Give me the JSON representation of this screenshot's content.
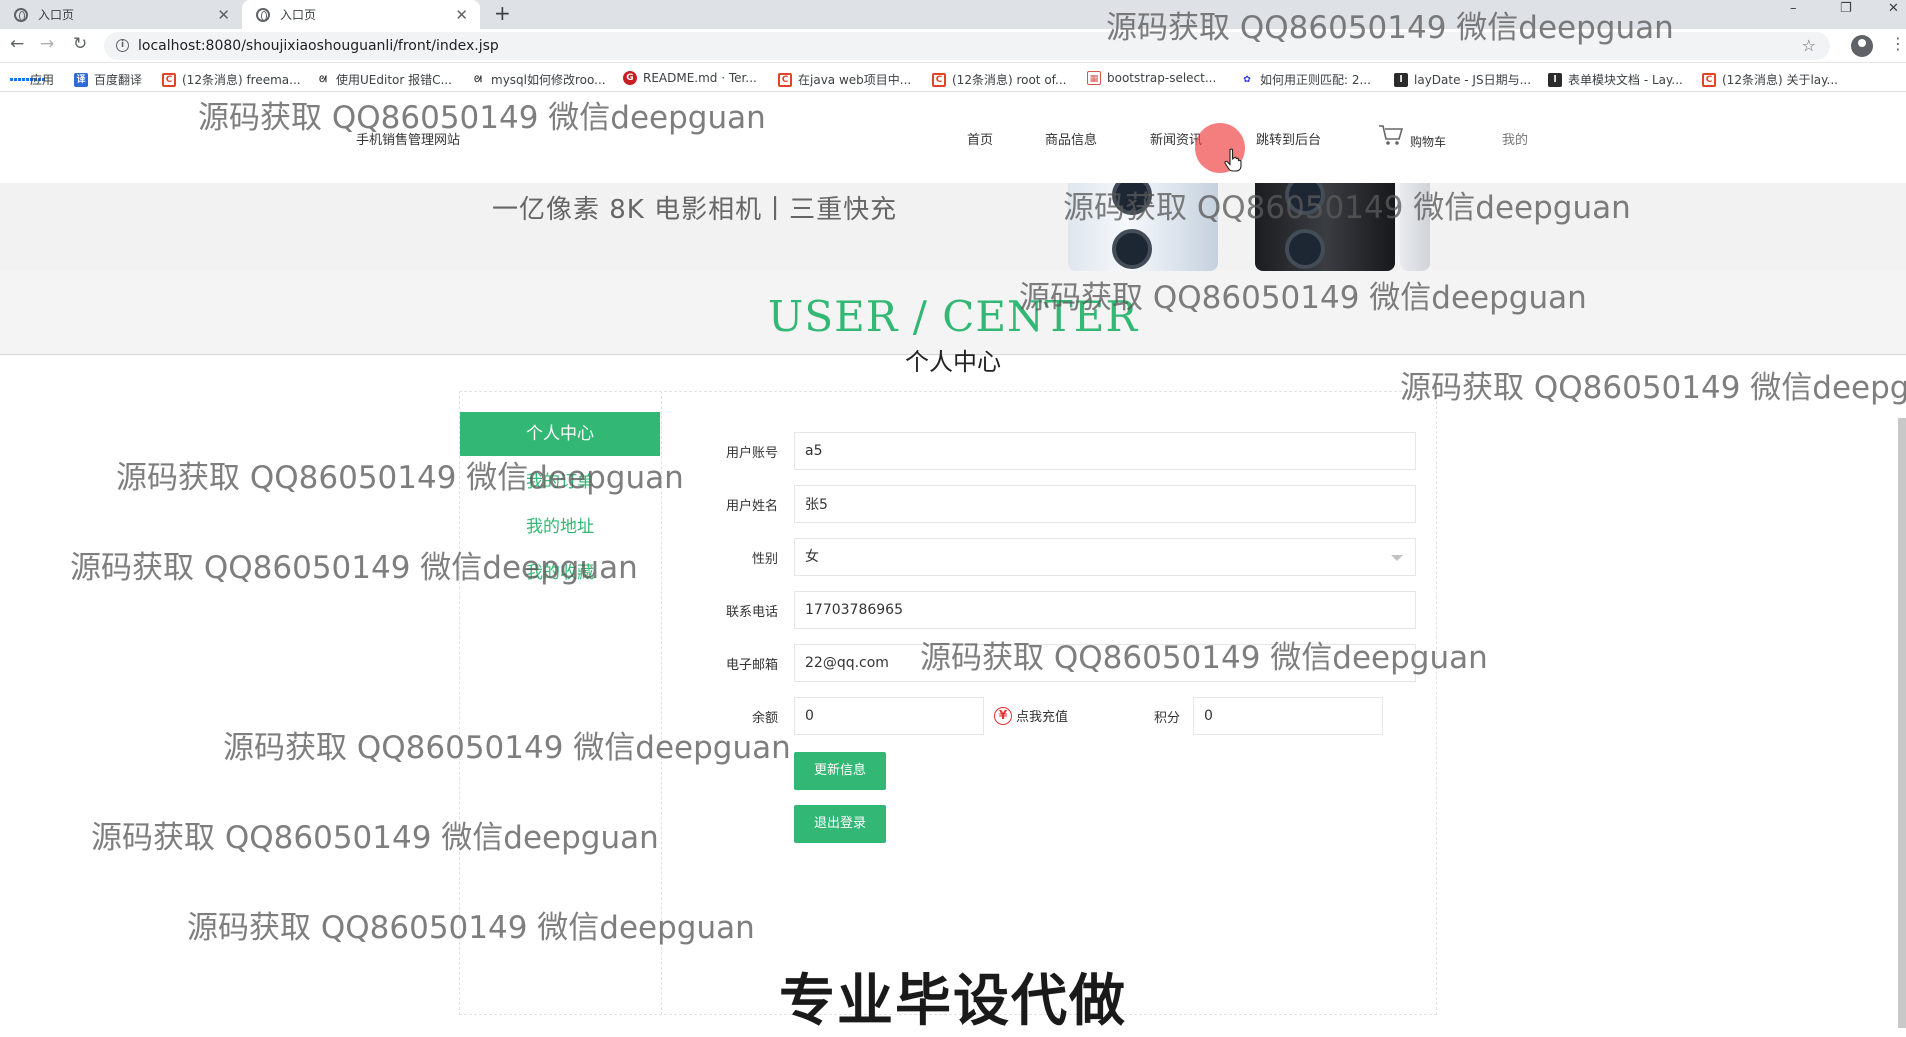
{
  "browser": {
    "tabs": [
      {
        "title": "入口页",
        "active": false
      },
      {
        "title": "入口页",
        "active": true
      }
    ],
    "new_tab": "+",
    "window_controls": {
      "minimize": "–",
      "restore": "❐",
      "close": "✕"
    },
    "url": "localhost:8080/shoujixiaoshouguanli/front/index.jsp",
    "bookmarks": [
      {
        "label": "应用",
        "icon": "apps-grid-icon"
      },
      {
        "label": "百度翻译",
        "icon": "baidu-translate-icon"
      },
      {
        "label": "(12条消息) freema...",
        "icon": "csdn-icon"
      },
      {
        "label": "使用UEditor 报错C...",
        "icon": "github-cat-icon"
      },
      {
        "label": "mysql如何修改roo...",
        "icon": "github-cat-icon"
      },
      {
        "label": "README.md · Ter...",
        "icon": "gitee-icon"
      },
      {
        "label": "在java web项目中...",
        "icon": "csdn-icon"
      },
      {
        "label": "(12条消息) root of...",
        "icon": "csdn-icon"
      },
      {
        "label": "bootstrap-select...",
        "icon": "page-icon"
      },
      {
        "label": "如何用正则匹配: 2...",
        "icon": "paw-icon"
      },
      {
        "label": "layDate - JS日期与...",
        "icon": "layui-icon"
      },
      {
        "label": "表单模块文档 - Lay...",
        "icon": "layui-icon"
      },
      {
        "label": "(12条消息) 关于lay...",
        "icon": "csdn-icon"
      }
    ]
  },
  "header": {
    "site_name": "手机销售管理网站",
    "nav": [
      "首页",
      "商品信息",
      "新闻资讯",
      "跳转到后台",
      "购物车",
      "我的"
    ]
  },
  "banner": {
    "slogan": "一亿像素 8K 电影相机丨三重快充"
  },
  "section": {
    "en_title": "USER / CENTER",
    "cn_title": "个人中心"
  },
  "sidebar": {
    "items": [
      {
        "label": "个人中心",
        "active": true
      },
      {
        "label": "我的订单",
        "active": false
      },
      {
        "label": "我的地址",
        "active": false
      },
      {
        "label": "我的收藏",
        "active": false
      }
    ]
  },
  "form": {
    "account_label": "用户账号",
    "account_value": "a5",
    "name_label": "用户姓名",
    "name_value": "张5",
    "gender_label": "性别",
    "gender_value": "女",
    "phone_label": "联系电话",
    "phone_value": "17703786965",
    "email_label": "电子邮箱",
    "email_value": "22@qq.com",
    "balance_label": "余额",
    "balance_value": "0",
    "recharge_label": "点我充值",
    "points_label": "积分",
    "points_value": "0",
    "update_button": "更新信息",
    "logout_button": "退出登录"
  },
  "footer_slogan": "专业毕设代做",
  "watermark_text": "源码获取 QQ86050149 微信deepguan",
  "colors": {
    "accent": "#32b874",
    "recharge": "#e53333",
    "cursor": "#f04646"
  }
}
